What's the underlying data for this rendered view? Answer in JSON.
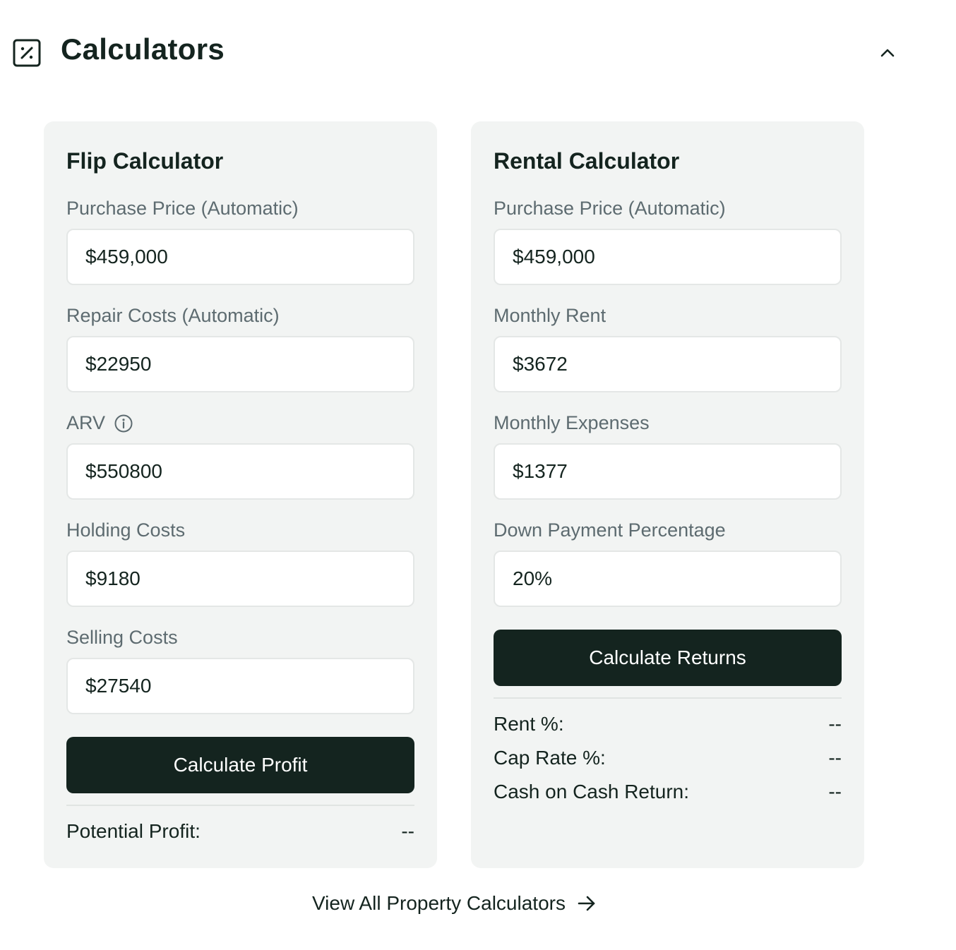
{
  "header": {
    "title": "Calculators",
    "icon": "calculator-icon",
    "collapse_icon": "chevron-up-icon"
  },
  "flip": {
    "title": "Flip Calculator",
    "fields": [
      {
        "label": "Purchase Price (Automatic)",
        "value": "$459,000"
      },
      {
        "label": "Repair Costs (Automatic)",
        "value": "$22950"
      },
      {
        "label": "ARV",
        "value": "$550800",
        "icon": "info-icon"
      },
      {
        "label": "Holding Costs",
        "value": "$9180"
      },
      {
        "label": "Selling Costs",
        "value": "$27540"
      }
    ],
    "button": "Calculate Profit",
    "results": [
      {
        "label": "Potential Profit:",
        "value": "--"
      }
    ]
  },
  "rental": {
    "title": "Rental Calculator",
    "fields": [
      {
        "label": "Purchase Price (Automatic)",
        "value": "$459,000"
      },
      {
        "label": "Monthly Rent",
        "value": "$3672"
      },
      {
        "label": "Monthly Expenses",
        "value": "$1377"
      },
      {
        "label": "Down Payment Percentage",
        "value": "20%"
      }
    ],
    "button": "Calculate Returns",
    "results": [
      {
        "label": "Rent %:",
        "value": "--"
      },
      {
        "label": "Cap Rate %:",
        "value": "--"
      },
      {
        "label": "Cash on Cash Return:",
        "value": "--"
      }
    ]
  },
  "footer": {
    "link": "View All Property Calculators",
    "icon": "arrow-right-icon"
  },
  "colors": {
    "primary": "#14241f",
    "card_bg": "#f2f4f3",
    "label": "#5d6b70"
  }
}
